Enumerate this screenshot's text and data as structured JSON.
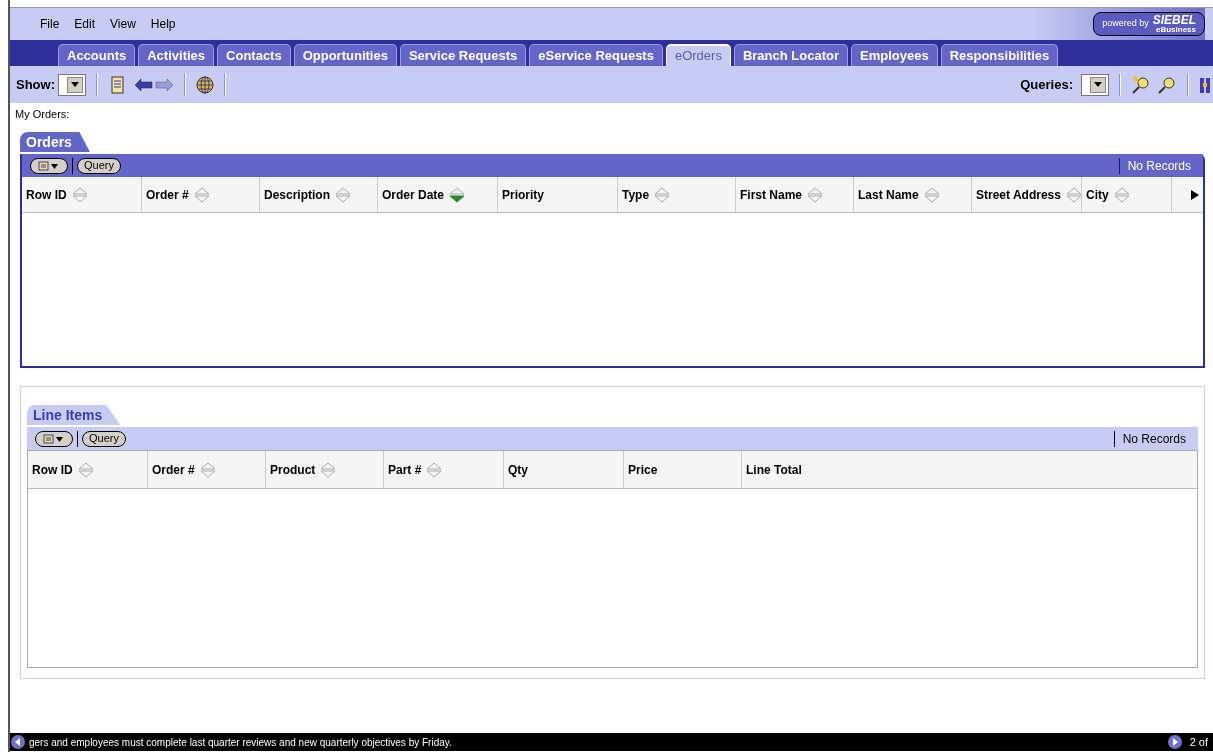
{
  "menu": [
    "File",
    "Edit",
    "View",
    "Help"
  ],
  "brand": {
    "powered": "powered by",
    "name": "SIEBEL",
    "sub": "eBusiness"
  },
  "tabs": [
    {
      "label": "Accounts",
      "selected": false
    },
    {
      "label": "Activities",
      "selected": false
    },
    {
      "label": "Contacts",
      "selected": false
    },
    {
      "label": "Opportunities",
      "selected": false
    },
    {
      "label": "Service Requests",
      "selected": false
    },
    {
      "label": "eService Requests",
      "selected": false
    },
    {
      "label": "eOrders",
      "selected": true
    },
    {
      "label": "Branch Locator",
      "selected": false
    },
    {
      "label": "Employees",
      "selected": false
    },
    {
      "label": "Responsibilities",
      "selected": false
    }
  ],
  "toolbar": {
    "show_label": "Show:",
    "queries_label": "Queries:"
  },
  "page_title": "My Orders:",
  "applets": [
    {
      "title": "Orders",
      "active": true,
      "query_button": "Query",
      "record_count": "No Records",
      "more_columns": true,
      "columns": [
        {
          "label": "Row ID",
          "kind": "sortable"
        },
        {
          "label": "Order #",
          "kind": "sortable"
        },
        {
          "label": "Description",
          "kind": "sortable"
        },
        {
          "label": "Order Date",
          "kind": "sorted"
        },
        {
          "label": "Priority",
          "kind": "plain"
        },
        {
          "label": "Type",
          "kind": "sortable"
        },
        {
          "label": "First Name",
          "kind": "sortable"
        },
        {
          "label": "Last Name",
          "kind": "sortable"
        },
        {
          "label": "Street Address",
          "kind": "sortable"
        },
        {
          "label": "City",
          "kind": "sortable"
        }
      ]
    },
    {
      "title": "Line Items",
      "active": false,
      "query_button": "Query",
      "record_count": "No Records",
      "more_columns": false,
      "columns": [
        {
          "label": "Row ID",
          "kind": "sortable"
        },
        {
          "label": "Order #",
          "kind": "sortable"
        },
        {
          "label": "Product",
          "kind": "sortable"
        },
        {
          "label": "Part #",
          "kind": "sortable"
        },
        {
          "label": "Qty",
          "kind": "plain"
        },
        {
          "label": "Price",
          "kind": "plain"
        },
        {
          "label": "Line Total",
          "kind": "plain"
        }
      ]
    }
  ],
  "status_bar": {
    "message": "gers and employees must complete last quarter reviews and new quarterly objectives by Friday.",
    "position": "2 of"
  }
}
